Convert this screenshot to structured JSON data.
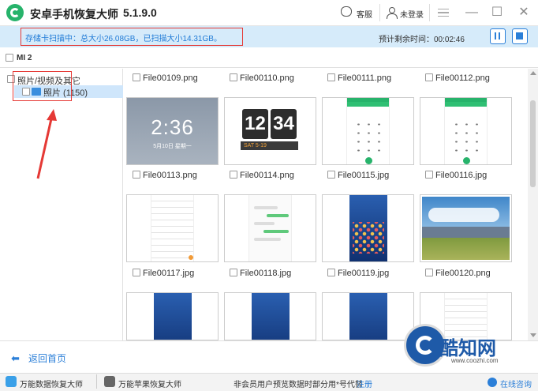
{
  "app": {
    "title": "安卓手机恢复大师",
    "version": "5.1.9.0"
  },
  "titlebar": {
    "service_label": "客服",
    "user_label": "未登录",
    "menu_icon": "menu-icon",
    "minimize_label": "—",
    "maximize_label": "☐",
    "close_label": "✕"
  },
  "status": {
    "scan_text": "存储卡扫描中：总大小26.08GB，已扫描大小14.31GB。",
    "remaining_text": "预计剩余时间：00:02:46"
  },
  "device": {
    "label": "MI 2"
  },
  "tree": {
    "category_label": "照片/视频及其它",
    "photo_label": "照片 (1150)"
  },
  "files": [
    {
      "name": "File00109.png",
      "thumb": "lock-screen"
    },
    {
      "name": "File00110.png",
      "thumb": "flip-clock"
    },
    {
      "name": "File00111.png",
      "thumb": "dialer"
    },
    {
      "name": "File00112.png",
      "thumb": "dialer"
    },
    {
      "name": "File00113.png",
      "thumb": "settings"
    },
    {
      "name": "File00114.png",
      "thumb": "chat"
    },
    {
      "name": "File00115.jpg",
      "thumb": "home-screen"
    },
    {
      "name": "File00116.jpg",
      "thumb": "landscape"
    },
    {
      "name": "File00117.jpg",
      "thumb": "home-screen"
    },
    {
      "name": "File00118.jpg",
      "thumb": "home-screen"
    },
    {
      "name": "File00119.jpg",
      "thumb": "home-screen"
    },
    {
      "name": "File00120.png",
      "thumb": "settings"
    }
  ],
  "thumbs_text": {
    "lock_time": "2:36",
    "lock_date": "5月10日 星期一",
    "flip_hour": "12",
    "flip_min": "34",
    "flip_strip": "SAT    5-19"
  },
  "bottom": {
    "back_label": "返回首页",
    "product1_label": "万能数据恢复大师",
    "product2_label": "万能苹果恢复大师",
    "notice_text": "非会员用户预览数据时部分用*号代替",
    "register_label": "注册",
    "online_label": "在线咨询"
  },
  "watermark": {
    "brand": "酷知网",
    "url": "www.coozhi.com"
  },
  "colors": {
    "accent": "#2b7fd8",
    "status_bg": "#d6ebfa",
    "logo_green": "#27b36b",
    "annotation_red": "#e53935"
  }
}
